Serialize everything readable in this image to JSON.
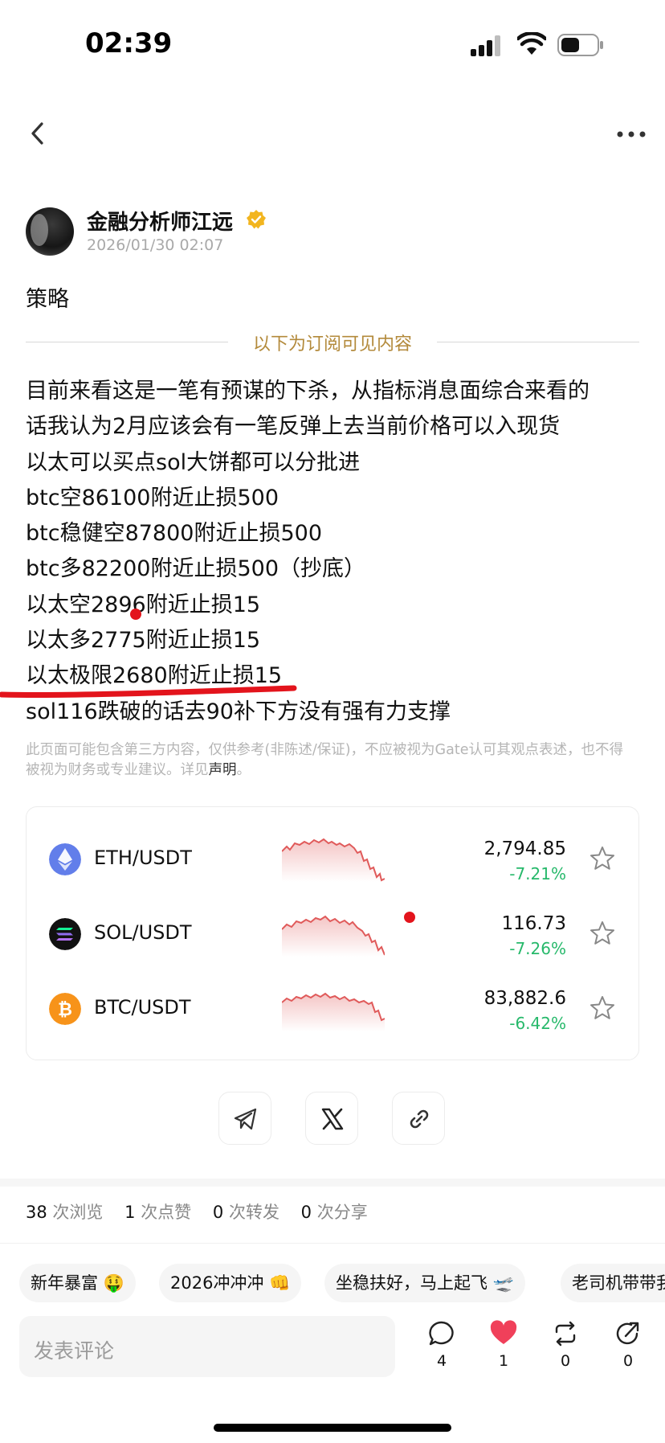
{
  "status_bar": {
    "time": "02:39"
  },
  "post": {
    "author_name": "金融分析师江远",
    "timestamp": "2026/01/30 02:07",
    "title": "策略",
    "subscriber_divider": "以下为订阅可见内容",
    "content_lines": [
      "目前来看这是一笔有预谋的下杀，从指标消息面综合来看的",
      "话我认为2月应该会有一笔反弹上去当前价格可以入现货",
      "以太可以买点sol大饼都可以分批进",
      "btc空86100附近止损500",
      "btc稳健空87800附近止损500",
      "btc多82200附近止损500（抄底）",
      "以太空2896附近止损15",
      "以太多2775附近止损15",
      "以太极限2680附近止损15",
      "sol116跌破的话去90补下方没有强有力支撑"
    ],
    "disclaimer_text": "此页面可能包含第三方内容，仅供参考(非陈述/保证)，不应被视为Gate认可其观点表述，也不得被视为财务或专业建议。详见",
    "disclaimer_link": "声明",
    "disclaimer_end": "。"
  },
  "markets": [
    {
      "pair": "ETH/USDT",
      "price": "2,794.85",
      "change": "-7.21%",
      "icon": "eth-icon",
      "color": "#627eea"
    },
    {
      "pair": "SOL/USDT",
      "price": "116.73",
      "change": "-7.26%",
      "icon": "sol-icon",
      "color": "#111111"
    },
    {
      "pair": "BTC/USDT",
      "price": "83,882.6",
      "change": "-6.42%",
      "icon": "btc-icon",
      "color": "#f7931a"
    }
  ],
  "share": {
    "buttons": [
      "telegram-icon",
      "x-icon",
      "link-icon"
    ]
  },
  "stats": {
    "views": "38",
    "views_label": "次浏览",
    "likes": "1",
    "likes_label": "次点赞",
    "reposts": "0",
    "reposts_label": "次转发",
    "shares": "0",
    "shares_label": "次分享"
  },
  "tags": [
    "新年暴富 🤑",
    "2026冲冲冲 👊",
    "坐稳扶好，马上起飞 🛫",
    "老司机带带我"
  ],
  "bottom_bar": {
    "comment_placeholder": "发表评论",
    "comment_count": "4",
    "like_count": "1",
    "repost_count": "0",
    "share_count": "0"
  },
  "colors": {
    "accent_gold": "#b38a3b",
    "positive_green": "#27b96b",
    "sparkline_red": "#e05a5a",
    "annotation_red": "#e3141c"
  }
}
